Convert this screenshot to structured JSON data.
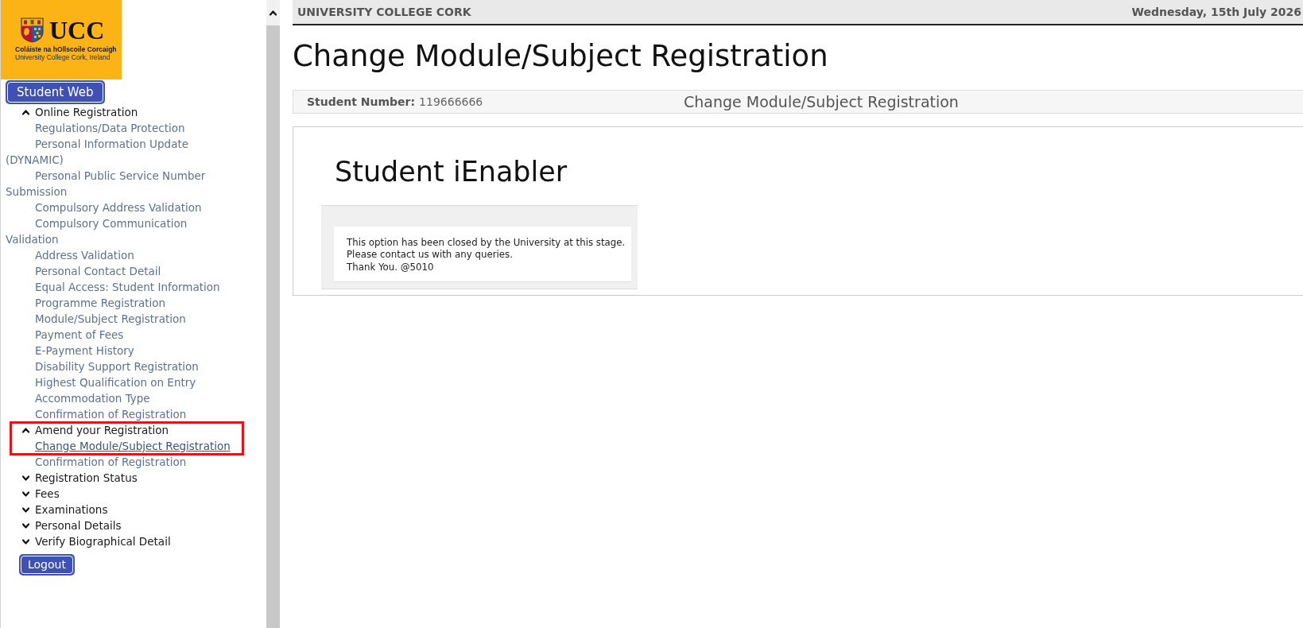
{
  "sidebar": {
    "logo": {
      "wordmark": "UCC",
      "name_irish": "Coláiste na hOllscoile Corcaigh",
      "name_english": "University College Cork, Ireland"
    },
    "home_button": "Student Web",
    "sections": [
      {
        "label": "Online Registration",
        "expanded": true,
        "framed": false,
        "children": [
          {
            "label": "Regulations/Data Protection",
            "selected": false
          },
          {
            "label": "Personal Information Update (DYNAMIC)",
            "selected": false
          },
          {
            "label": "Personal Public Service Number Submission",
            "selected": false
          },
          {
            "label": "Compulsory Address Validation",
            "selected": false
          },
          {
            "label": "Compulsory Communication Validation",
            "selected": false
          },
          {
            "label": "Address Validation",
            "selected": false
          },
          {
            "label": "Personal Contact Detail",
            "selected": false
          },
          {
            "label": "Equal Access: Student Information",
            "selected": false
          },
          {
            "label": "Programme Registration",
            "selected": false
          },
          {
            "label": "Module/Subject Registration",
            "selected": false
          },
          {
            "label": "Payment of Fees",
            "selected": false
          },
          {
            "label": "E-Payment History",
            "selected": false
          },
          {
            "label": "Disability Support Registration",
            "selected": false
          },
          {
            "label": "Highest Qualification on Entry",
            "selected": false
          },
          {
            "label": "Accommodation Type",
            "selected": false
          },
          {
            "label": "Confirmation of Registration",
            "selected": false
          }
        ]
      },
      {
        "label": "Amend your Registration",
        "expanded": true,
        "framed": true,
        "children": [
          {
            "label": "Change Module/Subject Registration",
            "selected": true
          },
          {
            "label": "Confirmation of Registration",
            "selected": false
          }
        ]
      },
      {
        "label": "Registration Status",
        "expanded": false,
        "framed": false
      },
      {
        "label": "Fees",
        "expanded": false,
        "framed": false
      },
      {
        "label": "Examinations",
        "expanded": false,
        "framed": false
      },
      {
        "label": "Personal Details",
        "expanded": false,
        "framed": false
      },
      {
        "label": "Verify Biographical Detail",
        "expanded": false,
        "framed": false
      }
    ],
    "logout_button": "Logout"
  },
  "top_bar": {
    "institution": "UNIVERSITY COLLEGE CORK",
    "date": "Wednesday, 15th July 2026"
  },
  "page_title": "Change Module/Subject Registration",
  "student_bar": {
    "label": "Student Number:",
    "value": "119666666",
    "title": "Change Module/Subject Registration"
  },
  "panel": {
    "title": "Student iEnabler",
    "message": "This option has been closed by the University at this stage.\nPlease contact us with any queries.\nThank You. @5010"
  }
}
